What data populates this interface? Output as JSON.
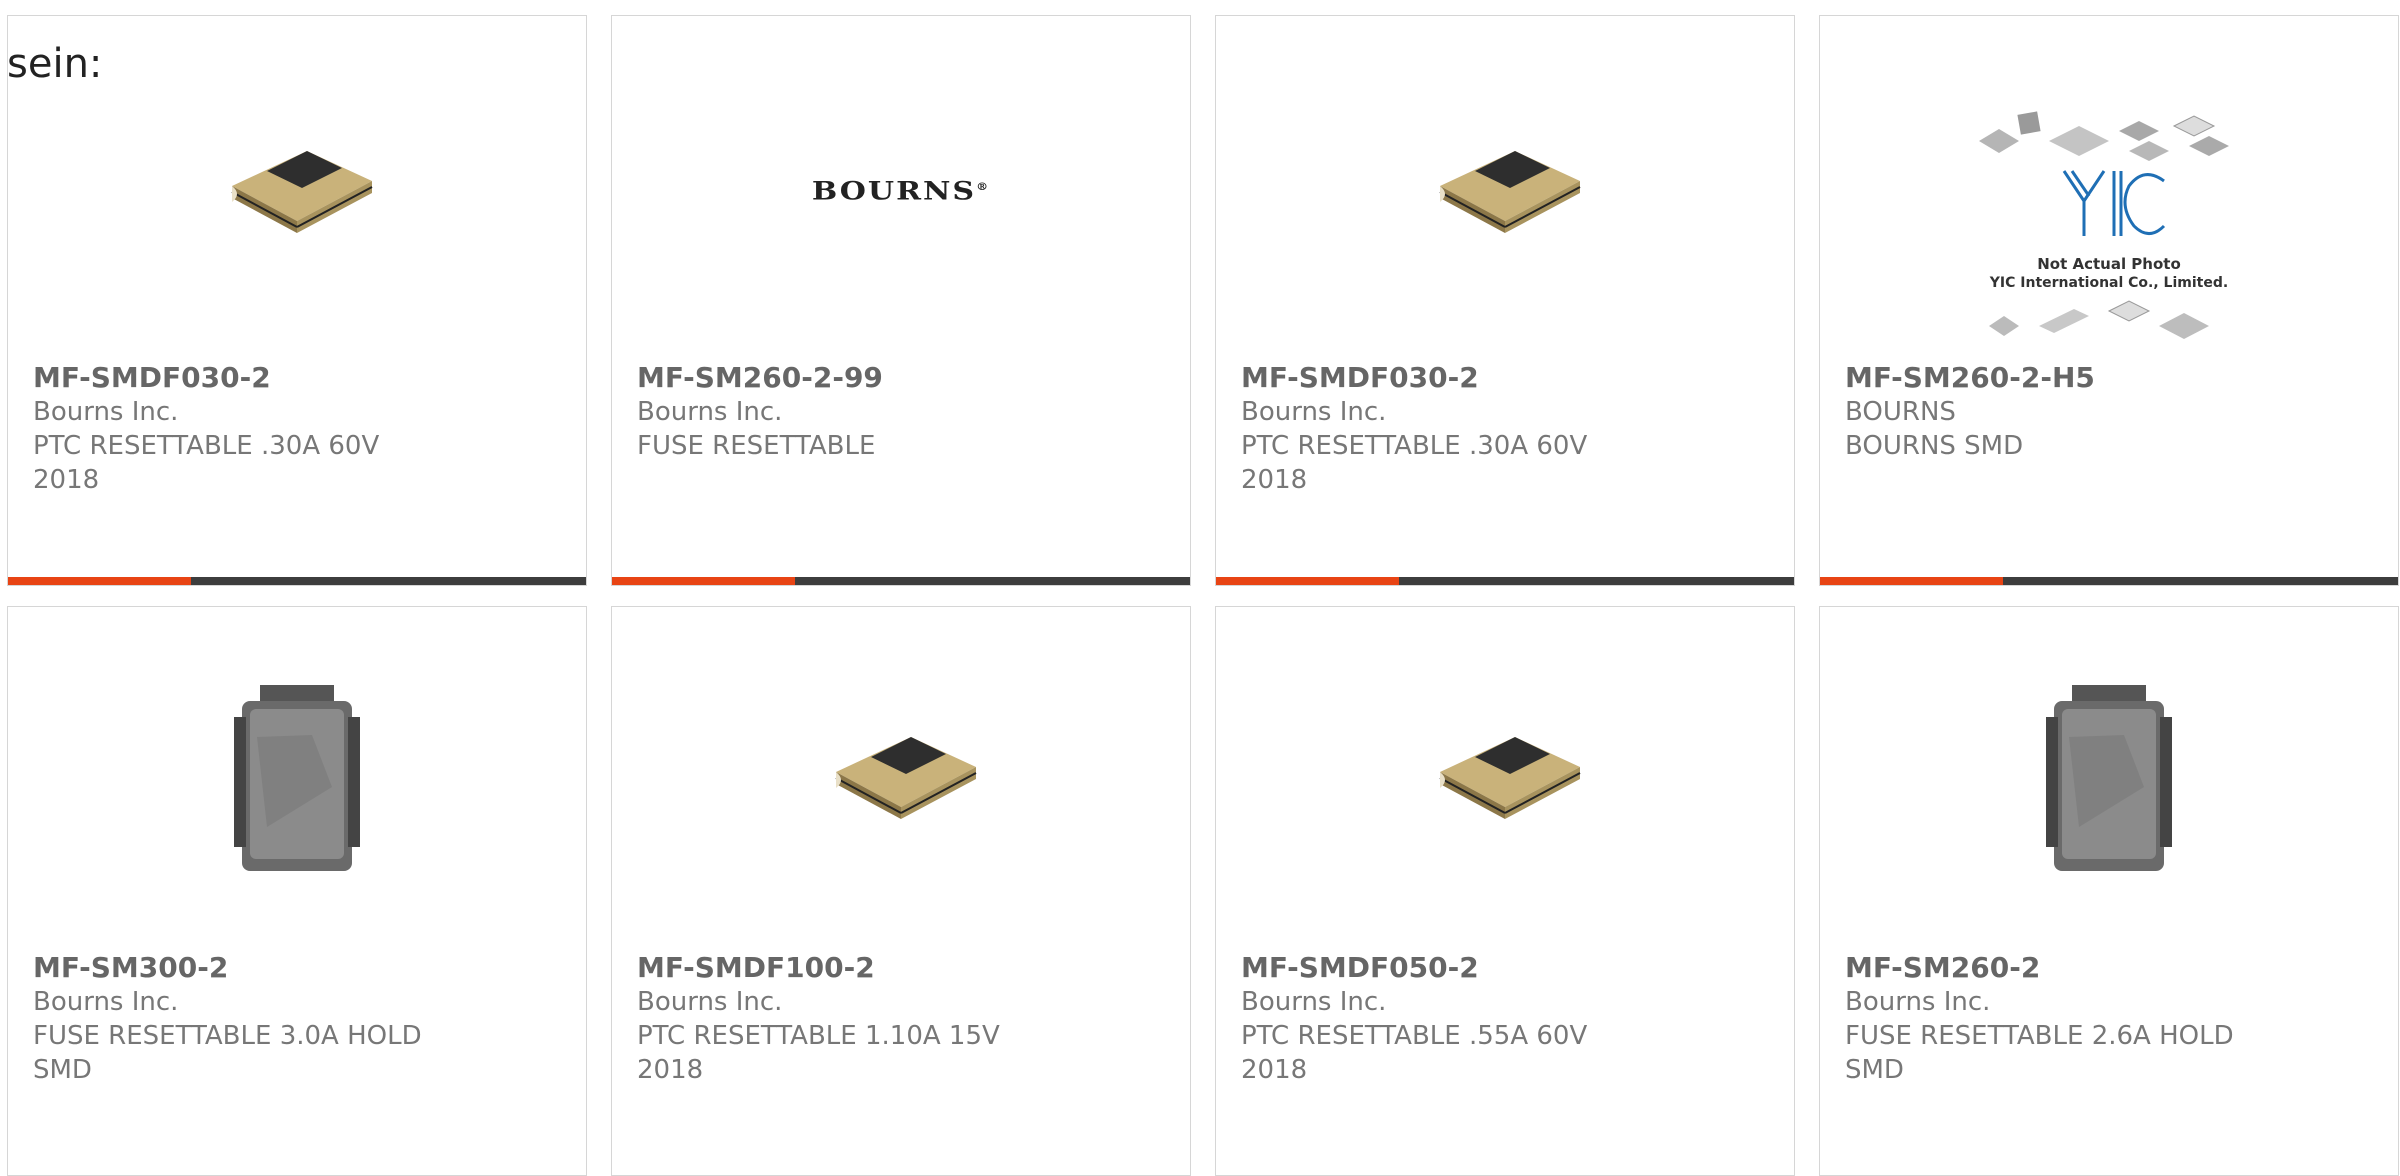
{
  "intro_text": "sein:",
  "colors": {
    "accent": "#e84414",
    "bar": "#3d3d3d",
    "border": "#d6d6d6",
    "text": "#777777"
  },
  "products": [
    {
      "part_number": "MF-SMDF030-2",
      "manufacturer": "Bourns Inc.",
      "description": "PTC RESETTABLE .30A 60V 2018",
      "image": "smd-chip-photo"
    },
    {
      "part_number": "MF-SM260-2-99",
      "manufacturer": "Bourns Inc.",
      "description": "FUSE RESETTABLE",
      "image": "bourns-logo",
      "logo_text": "BOURNS"
    },
    {
      "part_number": "MF-SMDF030-2",
      "manufacturer": "Bourns Inc.",
      "description": "PTC RESETTABLE .30A 60V 2018",
      "image": "smd-chip-photo"
    },
    {
      "part_number": "MF-SM260-2-H5",
      "manufacturer": "BOURNS",
      "description": "BOURNS SMD",
      "image": "yic-placeholder",
      "placeholder_logo": "YIC",
      "placeholder_line1": "Not Actual Photo",
      "placeholder_line2": "YIC International Co., Limited."
    },
    {
      "part_number": "MF-SM300-2",
      "manufacturer": "Bourns Inc.",
      "description": "FUSE RESETTABLE 3.0A HOLD SMD",
      "image": "metal-fuse-photo"
    },
    {
      "part_number": "MF-SMDF100-2",
      "manufacturer": "Bourns Inc.",
      "description": "PTC RESETTABLE 1.10A 15V 2018",
      "image": "smd-chip-photo"
    },
    {
      "part_number": "MF-SMDF050-2",
      "manufacturer": "Bourns Inc.",
      "description": "PTC RESETTABLE .55A 60V 2018",
      "image": "smd-chip-photo"
    },
    {
      "part_number": "MF-SM260-2",
      "manufacturer": "Bourns Inc.",
      "description": "FUSE RESETTABLE 2.6A HOLD SMD",
      "image": "metal-fuse-photo"
    }
  ]
}
